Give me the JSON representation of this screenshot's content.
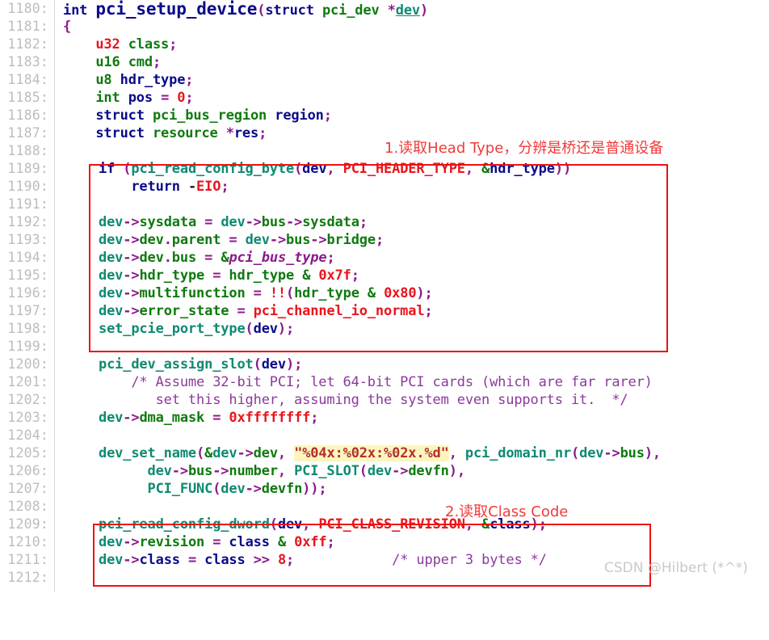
{
  "editor": {
    "first_line_number": 1180,
    "line_number_suffix": ":",
    "gutter_color": "#bdbdbd",
    "background": "#ffffff"
  },
  "lines": [
    {
      "num": "1180:",
      "text": "int pci_setup_device(struct pci_dev *dev)"
    },
    {
      "num": "1181:",
      "text": "{"
    },
    {
      "num": "1182:",
      "text": "    u32 class;"
    },
    {
      "num": "1183:",
      "text": "    u16 cmd;"
    },
    {
      "num": "1184:",
      "text": "    u8 hdr_type;"
    },
    {
      "num": "1185:",
      "text": "    int pos = 0;"
    },
    {
      "num": "1186:",
      "text": "    struct pci_bus_region region;"
    },
    {
      "num": "1187:",
      "text": "    struct resource *res;"
    },
    {
      "num": "1188:",
      "text": ""
    },
    {
      "num": "1189:",
      "text": "    if (pci_read_config_byte(dev, PCI_HEADER_TYPE, &hdr_type))"
    },
    {
      "num": "1190:",
      "text": "        return -EIO;"
    },
    {
      "num": "1191:",
      "text": ""
    },
    {
      "num": "1192:",
      "text": "    dev->sysdata = dev->bus->sysdata;"
    },
    {
      "num": "1193:",
      "text": "    dev->dev.parent = dev->bus->bridge;"
    },
    {
      "num": "1194:",
      "text": "    dev->dev.bus = &pci_bus_type;"
    },
    {
      "num": "1195:",
      "text": "    dev->hdr_type = hdr_type & 0x7f;"
    },
    {
      "num": "1196:",
      "text": "    dev->multifunction = !!(hdr_type & 0x80);"
    },
    {
      "num": "1197:",
      "text": "    dev->error_state = pci_channel_io_normal;"
    },
    {
      "num": "1198:",
      "text": "    set_pcie_port_type(dev);"
    },
    {
      "num": "1199:",
      "text": ""
    },
    {
      "num": "1200:",
      "text": "    pci_dev_assign_slot(dev);"
    },
    {
      "num": "1201:",
      "text": "    /* Assume 32-bit PCI; let 64-bit PCI cards (which are far rarer)"
    },
    {
      "num": "1202:",
      "text": "       set this higher, assuming the system even supports it.  */"
    },
    {
      "num": "1203:",
      "text": "    dev->dma_mask = 0xffffffff;"
    },
    {
      "num": "1204:",
      "text": ""
    },
    {
      "num": "1205:",
      "text": "    dev_set_name(&dev->dev, \"%04x:%02x:%02x.%d\", pci_domain_nr(dev->bus),"
    },
    {
      "num": "1206:",
      "text": "         dev->bus->number, PCI_SLOT(dev->devfn),"
    },
    {
      "num": "1207:",
      "text": "         PCI_FUNC(dev->devfn));"
    },
    {
      "num": "1208:",
      "text": ""
    },
    {
      "num": "1209:",
      "text": "    pci_read_config_dword(dev, PCI_CLASS_REVISION, &class);"
    },
    {
      "num": "1210:",
      "text": "    dev->revision = class & 0xff;"
    },
    {
      "num": "1211:",
      "text": "    dev->class = class >> 8;            /* upper 3 bytes */"
    },
    {
      "num": "1212:",
      "text": ""
    }
  ],
  "annotations": [
    {
      "id": "annotation-1",
      "text": "1.读取Head Type，分辨是桥还是普通设备",
      "color": "#f23a3a"
    },
    {
      "id": "annotation-2",
      "text": "2.读取Class Code",
      "color": "#f23a3a"
    }
  ],
  "highlight_boxes": [
    {
      "id": "highlight-box-header-type",
      "color": "#ee1111"
    },
    {
      "id": "highlight-box-class-code",
      "color": "#ee1111"
    }
  ],
  "watermark": {
    "text": "CSDN @Hilbert (*^*)",
    "color": "#c9c9c9"
  },
  "string_literal": "\"%04x:%02x:%02x.%d\"",
  "highlight_color": "#fcf6bd"
}
